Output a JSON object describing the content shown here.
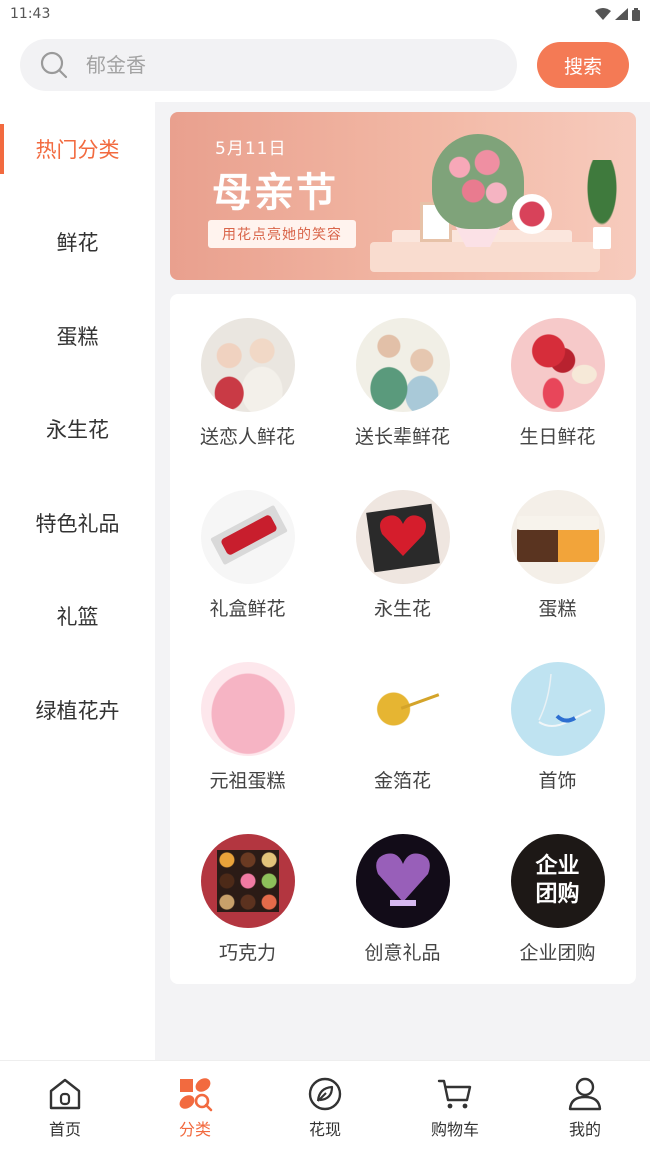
{
  "status_bar": {
    "time": "11:43"
  },
  "search": {
    "placeholder": "郁金香",
    "button_label": "搜索"
  },
  "sidebar": {
    "items": [
      {
        "label": "热门分类",
        "active": true
      },
      {
        "label": "鲜花",
        "active": false
      },
      {
        "label": "蛋糕",
        "active": false
      },
      {
        "label": "永生花",
        "active": false
      },
      {
        "label": "特色礼品",
        "active": false
      },
      {
        "label": "礼篮",
        "active": false
      },
      {
        "label": "绿植花卉",
        "active": false
      }
    ]
  },
  "banner": {
    "date": "5月11日",
    "title": "母亲节",
    "subtitle": "用花点亮她的笑容"
  },
  "categories": [
    {
      "label": "送恋人鲜花",
      "icon": "couple-photo"
    },
    {
      "label": "送长辈鲜花",
      "icon": "elders-photo"
    },
    {
      "label": "生日鲜花",
      "icon": "birthday-bouquet-photo"
    },
    {
      "label": "礼盒鲜花",
      "icon": "rose-gift-box-photo"
    },
    {
      "label": "永生花",
      "icon": "heart-rose-box-photo"
    },
    {
      "label": "蛋糕",
      "icon": "cake-photo"
    },
    {
      "label": "元祖蛋糕",
      "icon": "pink-cake-photo"
    },
    {
      "label": "金箔花",
      "icon": "gold-rose-photo"
    },
    {
      "label": "首饰",
      "icon": "swan-necklace-photo"
    },
    {
      "label": "巧克力",
      "icon": "chocolate-box-photo"
    },
    {
      "label": "创意礼品",
      "icon": "crystal-heart-photo"
    },
    {
      "label": "企业团购",
      "icon": "enterprise-logo",
      "logo_text": "企业团购"
    }
  ],
  "tabbar": {
    "items": [
      {
        "label": "首页",
        "icon": "home-icon",
        "active": false
      },
      {
        "label": "分类",
        "icon": "category-icon",
        "active": true
      },
      {
        "label": "花现",
        "icon": "discover-icon",
        "active": false
      },
      {
        "label": "购物车",
        "icon": "cart-icon",
        "active": false
      },
      {
        "label": "我的",
        "icon": "profile-icon",
        "active": false
      }
    ]
  },
  "colors": {
    "accent": "#f26a3f",
    "button": "#f47a55"
  }
}
